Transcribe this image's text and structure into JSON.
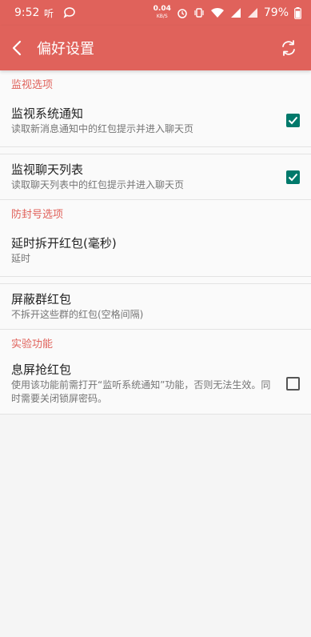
{
  "statusbar": {
    "time": "9:52",
    "speed_value": "0.04",
    "speed_unit": "KB/S",
    "battery": "79%"
  },
  "toolbar": {
    "title": "偏好设置"
  },
  "sections": {
    "monitor": {
      "header": "监视选项",
      "items": [
        {
          "title": "监视系统通知",
          "summary": "读取新消息通知中的红包提示并进入聊天页",
          "checked": true
        },
        {
          "title": "监视聊天列表",
          "summary": "读取聊天列表中的红包提示并进入聊天页",
          "checked": true
        }
      ]
    },
    "antiban": {
      "header": "防封号选项",
      "items": [
        {
          "title": "延时拆开红包(毫秒)",
          "summary": "延时"
        },
        {
          "title": "屏蔽群红包",
          "summary": "不拆开这些群的红包(空格间隔)"
        }
      ]
    },
    "experimental": {
      "header": "实验功能",
      "items": [
        {
          "title": "息屏抢红包",
          "summary": "使用该功能前需打开“监听系统通知”功能，否则无法生效。同时需要关闭锁屏密码。",
          "checked": false
        }
      ]
    }
  },
  "colors": {
    "accent": "#e0625b",
    "checkbox_on": "#00796b"
  }
}
